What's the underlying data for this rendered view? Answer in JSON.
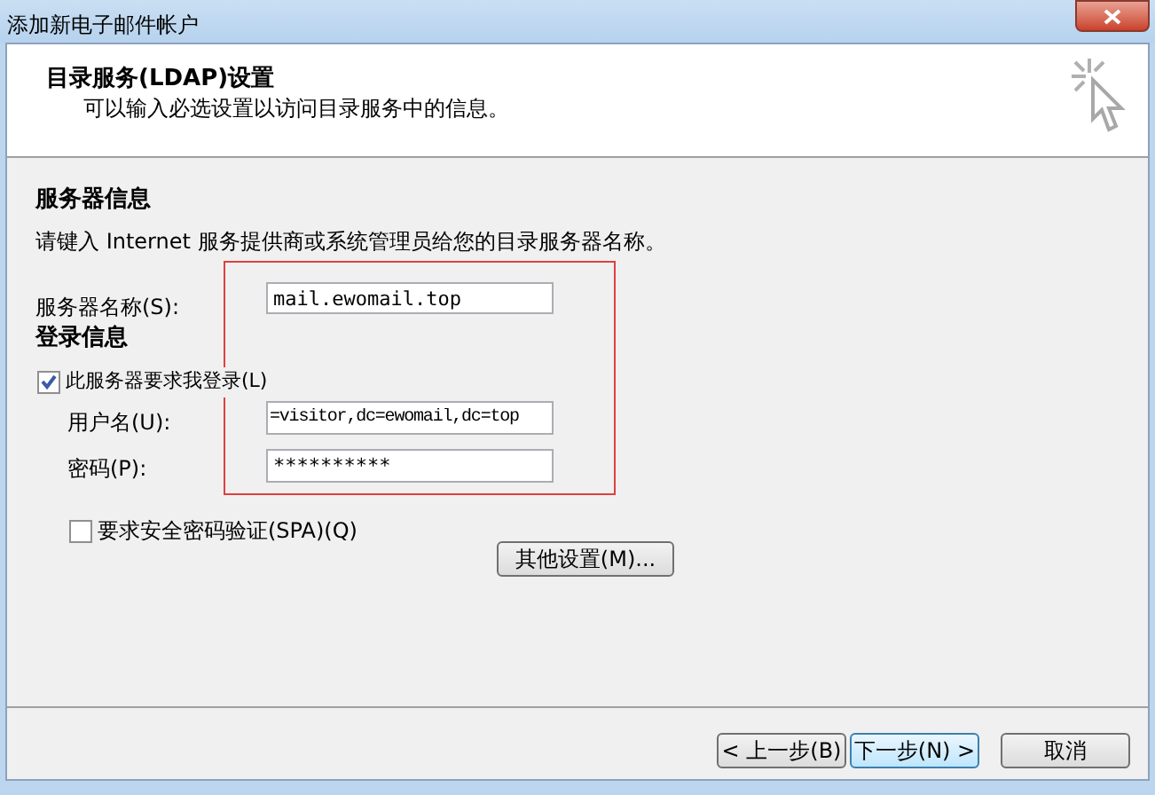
{
  "window": {
    "title": "添加新电子邮件帐户"
  },
  "header": {
    "title": "目录服务(LDAP)设置",
    "subtitle": "可以输入必选设置以访问目录服务中的信息。"
  },
  "server_section": {
    "heading": "服务器信息",
    "description": "请键入 Internet 服务提供商或系统管理员给您的目录服务器名称。",
    "server_label": "服务器名称(S):",
    "server_value": "mail.ewomail.top"
  },
  "login_section": {
    "heading": "登录信息",
    "require_login": {
      "label": "此服务器要求我登录(L)",
      "checked": true
    },
    "username_label": "用户名(U):",
    "username_value": "=visitor,dc=ewomail,dc=top",
    "password_label": "密码(P):",
    "password_value": "**********"
  },
  "spa": {
    "label": "要求安全密码验证(SPA)(Q)",
    "checked": false
  },
  "more_settings": "其他设置(M)...",
  "buttons": [
    {
      "label": "< 上一步(B)",
      "focused": false
    },
    {
      "label": "下一步(N) >",
      "focused": true
    },
    {
      "label": "取消",
      "focused": false
    }
  ]
}
